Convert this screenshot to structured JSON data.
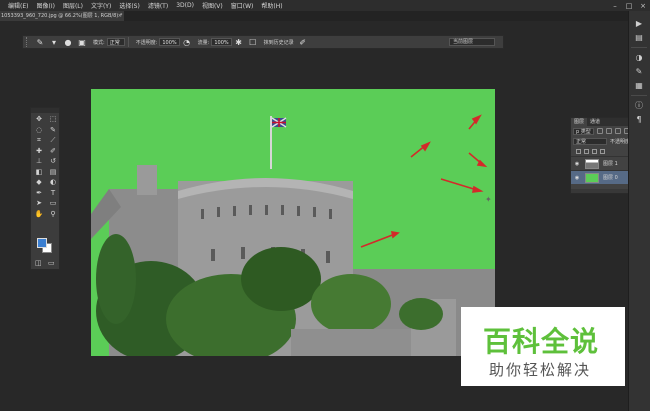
{
  "menu": {
    "items": [
      "",
      "编辑(E)",
      "图像(I)",
      "图层(L)",
      "文字(Y)",
      "选择(S)",
      "滤镜(T)",
      "3D(D)",
      "视图(V)",
      "窗口(W)",
      "帮助(H)"
    ]
  },
  "document_tab": {
    "title": "1053393_960_720.jpg @ 66.2%(图层 1, RGB/8) *",
    "close": "×"
  },
  "options_bar": {
    "mode_label": "模式:",
    "mode_value": "正常",
    "opacity_label": "不透明度:",
    "opacity_value": "100%",
    "flow_label": "流量:",
    "flow_value": "100%",
    "history_label": "抹到历史记录",
    "sample_value": "当前图层"
  },
  "layers_panel": {
    "tabs": [
      "图层",
      "通道"
    ],
    "filter_kind": "p 类型",
    "blend_mode": "正常",
    "opacity_label": "不透明度:",
    "layers": [
      {
        "name": "图层 1",
        "selected": false,
        "thumb": "castle"
      },
      {
        "name": "图层 0",
        "selected": true,
        "thumb": "green"
      }
    ]
  },
  "watermark": {
    "title": "百科全说",
    "subtitle": "助你轻松解决"
  },
  "colors": {
    "canvas_bg": "#5bcd57",
    "foreground": "#3b7fd1",
    "background": "#ffffff",
    "arrow": "#d32a2a",
    "watermark_green": "#5ec03b"
  },
  "icons": {
    "tools": [
      "move-icon",
      "marquee-icon",
      "lasso-icon",
      "quick-select-icon",
      "crop-icon",
      "eyedropper-icon",
      "healing-icon",
      "brush-icon",
      "stamp-icon",
      "history-brush-icon",
      "eraser-icon",
      "gradient-icon",
      "blur-icon",
      "dodge-icon",
      "pen-icon",
      "type-icon",
      "path-select-icon",
      "shape-icon",
      "hand-icon",
      "zoom-icon"
    ]
  }
}
